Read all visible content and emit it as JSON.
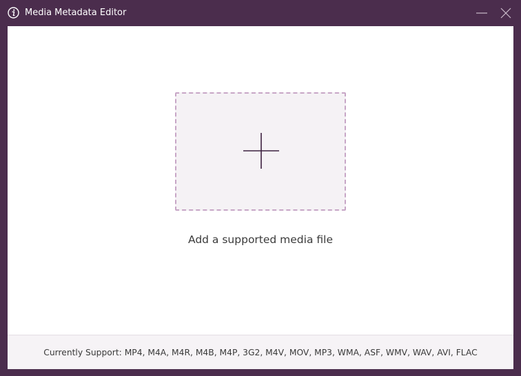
{
  "window": {
    "title": "Media Metadata Editor",
    "icons": {
      "app": "info-icon",
      "minimize": "minimize-icon",
      "close": "close-icon"
    }
  },
  "main": {
    "dropzone_icon": "plus-icon",
    "add_label": "Add a supported media file"
  },
  "footer": {
    "support_text": "Currently Support: MP4, M4A, M4R, M4B, M4P, 3G2, M4V, MOV, MP3, WMA, ASF, WMV, WAV, AVI, FLAC"
  },
  "colors": {
    "frame": "#4b2d4d",
    "dropzone_border": "#c7a6c6",
    "dropzone_fill": "#f5f2f5",
    "plus": "#3d2140"
  }
}
